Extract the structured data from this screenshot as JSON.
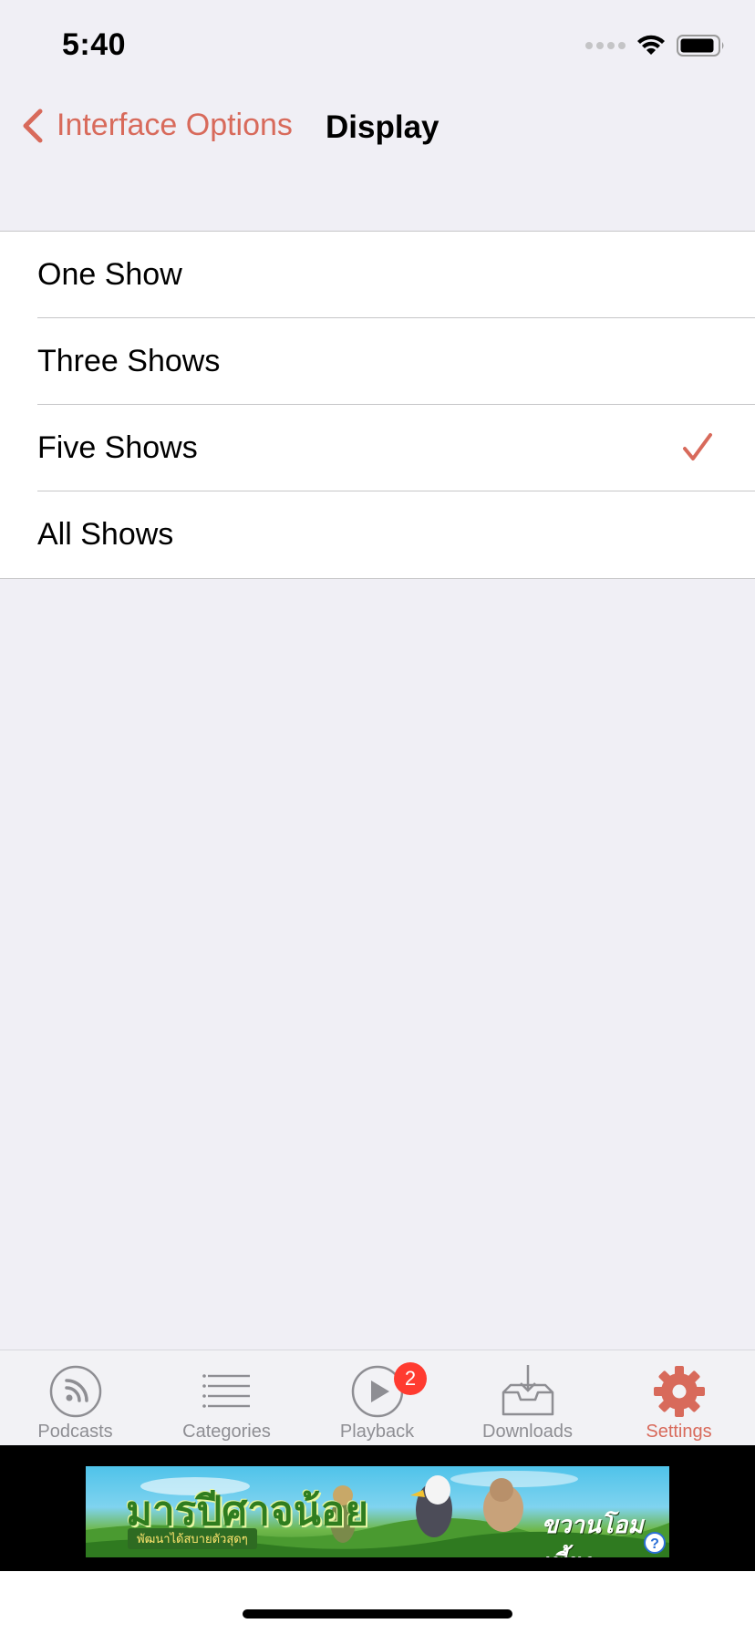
{
  "status_bar": {
    "time": "5:40",
    "icons": [
      "signal-icon",
      "wifi-icon",
      "battery-icon"
    ]
  },
  "nav": {
    "back_label": "Interface Options",
    "title": "Display"
  },
  "options": [
    {
      "label": "One Show",
      "selected": false
    },
    {
      "label": "Three Shows",
      "selected": false
    },
    {
      "label": "Five Shows",
      "selected": true
    },
    {
      "label": "All Shows",
      "selected": false
    }
  ],
  "tabs": [
    {
      "label": "Podcasts",
      "icon": "podcast-icon",
      "active": false
    },
    {
      "label": "Categories",
      "icon": "list-icon",
      "active": false
    },
    {
      "label": "Playback",
      "icon": "play-icon",
      "active": false,
      "badge": "2"
    },
    {
      "label": "Downloads",
      "icon": "download-tray-icon",
      "active": false
    },
    {
      "label": "Settings",
      "icon": "gear-icon",
      "active": true
    }
  ],
  "ad": {
    "title": "มารปีศาจน้อย",
    "subtitle": "พัฒนาได้สบายตัวสุดๆ",
    "right_title": "ขวานโอมเพี้ยง"
  },
  "colors": {
    "accent": "#d86a5b",
    "background": "#f0eff5",
    "separator": "#c6c6c8",
    "inactive_tab": "#8e8e93",
    "badge": "#ff3b30"
  }
}
